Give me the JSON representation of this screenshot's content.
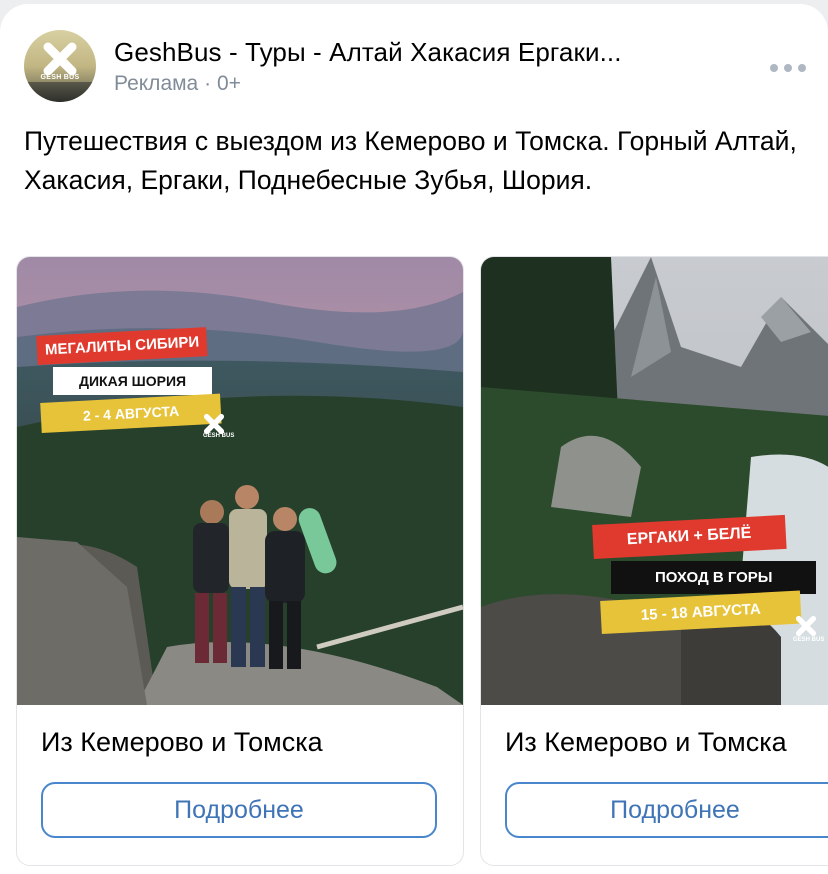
{
  "post": {
    "author": "GeshBus - Туры - Алтай Хакасия Ергаки...",
    "ad_label": "Реклама",
    "age_rating": "0+",
    "separator": "·",
    "text": "Путешествия с выездом из Кемерово и Томска. Горный Алтай, Хакасия, Ергаки, Поднебесные Зубья, Шория.",
    "avatar_text": "GESH BUS"
  },
  "cards": [
    {
      "tags": [
        "МЕГАЛИТЫ СИБИРИ",
        "ДИКАЯ ШОРИЯ",
        "2 - 4 АВГУСТА"
      ],
      "logo_text": "GESH BUS",
      "title": "Из Кемерово и Томска",
      "button": "Подробнее"
    },
    {
      "tags": [
        "ЕРГАКИ + БЕЛЁ",
        "ПОХОД В ГОРЫ",
        "15 - 18 АВГУСТА"
      ],
      "logo_text": "GESH BUS",
      "title": "Из Кемерово и Томска",
      "button": "Подробнее"
    }
  ],
  "colors": {
    "tag_red": "#e03a2f",
    "tag_yellow": "#e7c33a",
    "button_border": "#4986cc",
    "secondary_text": "#818c99"
  },
  "icons": [
    "gesh-bus-logo-icon",
    "more-dots-icon"
  ]
}
